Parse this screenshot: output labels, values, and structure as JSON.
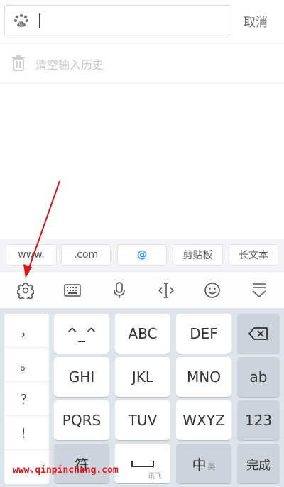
{
  "search": {
    "cancel_label": "取消",
    "icon": "baidu-paw-icon"
  },
  "history": {
    "clear_label": "清空输入历史",
    "icon": "trash-icon"
  },
  "suggestions": [
    {
      "label": "www."
    },
    {
      "label": ".com"
    },
    {
      "label": "@"
    },
    {
      "label": "剪贴板"
    },
    {
      "label": "长文本"
    }
  ],
  "toolbar": {
    "icons": [
      "gear-icon",
      "keyboard-icon",
      "microphone-icon",
      "cursor-icon",
      "emoji-icon",
      "collapse-keyboard-icon"
    ]
  },
  "keyboard": {
    "side_keys": [
      "，",
      "。",
      "？",
      "！",
      "…"
    ],
    "row1": [
      "^_^",
      "ABC",
      "DEF"
    ],
    "row2": [
      "GHI",
      "JKL",
      "MNO",
      "ab"
    ],
    "row3": [
      "PQRS",
      "TUV",
      "WXYZ",
      "123"
    ],
    "bottom": {
      "symbol": "符",
      "space_brand": "讯飞",
      "chinese": "中",
      "english_small": "英",
      "done": "完成"
    }
  },
  "watermark": "www.qinpinchang.com",
  "colors": {
    "accent": "#1a8cff",
    "arrow": "#e0131a",
    "keyboard_bg": "#dfe3ea"
  }
}
